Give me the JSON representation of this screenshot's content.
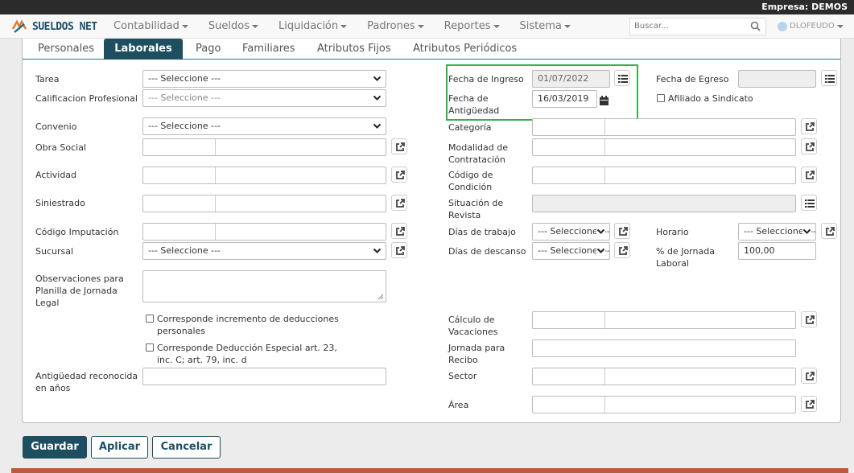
{
  "topbar": {
    "company": "Empresa: DEMOS"
  },
  "navbar": {
    "brand": "SUELDOS NET",
    "menu": [
      "Contabilidad",
      "Sueldos",
      "Liquidación",
      "Padrones",
      "Reportes",
      "Sistema"
    ],
    "search_placeholder": "Buscar...",
    "user": "DLOFEUDO"
  },
  "tabs": [
    "Personales",
    "Laborales",
    "Pago",
    "Familiares",
    "Atributos Fijos",
    "Atributos Periódicos"
  ],
  "form": {
    "tarea": {
      "label": "Tarea",
      "value": "--- Seleccione ---"
    },
    "calificacion": {
      "label": "Calificacion Profesional",
      "value": "--- Seleccione ---"
    },
    "convenio": {
      "label": "Convenio",
      "value": "--- Seleccione ---"
    },
    "obra_social": {
      "label": "Obra Social"
    },
    "actividad": {
      "label": "Actividad"
    },
    "siniestrado": {
      "label": "Siniestrado"
    },
    "codigo_imputacion": {
      "label": "Código Imputación"
    },
    "sucursal": {
      "label": "Sucursal",
      "value": "--- Seleccione ---"
    },
    "observaciones": {
      "label_lines": [
        "Observaciones para",
        "Planilla de Jornada",
        "Legal"
      ]
    },
    "chk_incremento": {
      "lines": [
        "Corresponde incremento de deducciones",
        "personales"
      ]
    },
    "chk_deduccion": {
      "lines": [
        "Corresponde Deducción Especial art. 23,",
        "inc. C; art. 79, inc. d"
      ]
    },
    "antiguedad_reconocida": {
      "label_lines": [
        "Antigüedad reconocida",
        "en años"
      ]
    },
    "fecha_ingreso": {
      "label": "Fecha de Ingreso",
      "value": "01/07/2022"
    },
    "fecha_antiguedad": {
      "label_lines": [
        "Fecha de",
        "Antigüedad"
      ],
      "value": "16/03/2019"
    },
    "fecha_egreso": {
      "label": "Fecha de Egreso"
    },
    "afiliado_sindicato": {
      "label": "Afiliado a Sindicato"
    },
    "categoria": {
      "label": "Categoría"
    },
    "modalidad": {
      "label_lines": [
        "Modalidad de",
        "Contratación"
      ]
    },
    "codigo_condicion": {
      "label_lines": [
        "Código de",
        "Condición"
      ]
    },
    "situacion_revista": {
      "label_lines": [
        "Situación de",
        "Revista"
      ]
    },
    "dias_trabajo": {
      "label": "Días de trabajo",
      "value": "--- Seleccione ---"
    },
    "dias_descanso": {
      "label": "Días de descanso",
      "value": "--- Seleccione ---"
    },
    "horario": {
      "label": "Horario",
      "value": "--- Seleccione ---"
    },
    "jornada_laboral": {
      "label_lines": [
        "% de Jornada",
        "Laboral"
      ],
      "value": "100,00"
    },
    "calculo_vacaciones": {
      "label_lines": [
        "Cálculo de",
        "Vacaciones"
      ]
    },
    "jornada_recibo": {
      "label_lines": [
        "Jornada para",
        "Recibo"
      ]
    },
    "sector": {
      "label": "Sector"
    },
    "area": {
      "label": "Área"
    }
  },
  "actions": {
    "save": "Guardar",
    "apply": "Aplicar",
    "cancel": "Cancelar"
  },
  "colors": {
    "primary": "#1e4f60",
    "highlight": "#3aad4d",
    "footer": "#b85c3b"
  }
}
